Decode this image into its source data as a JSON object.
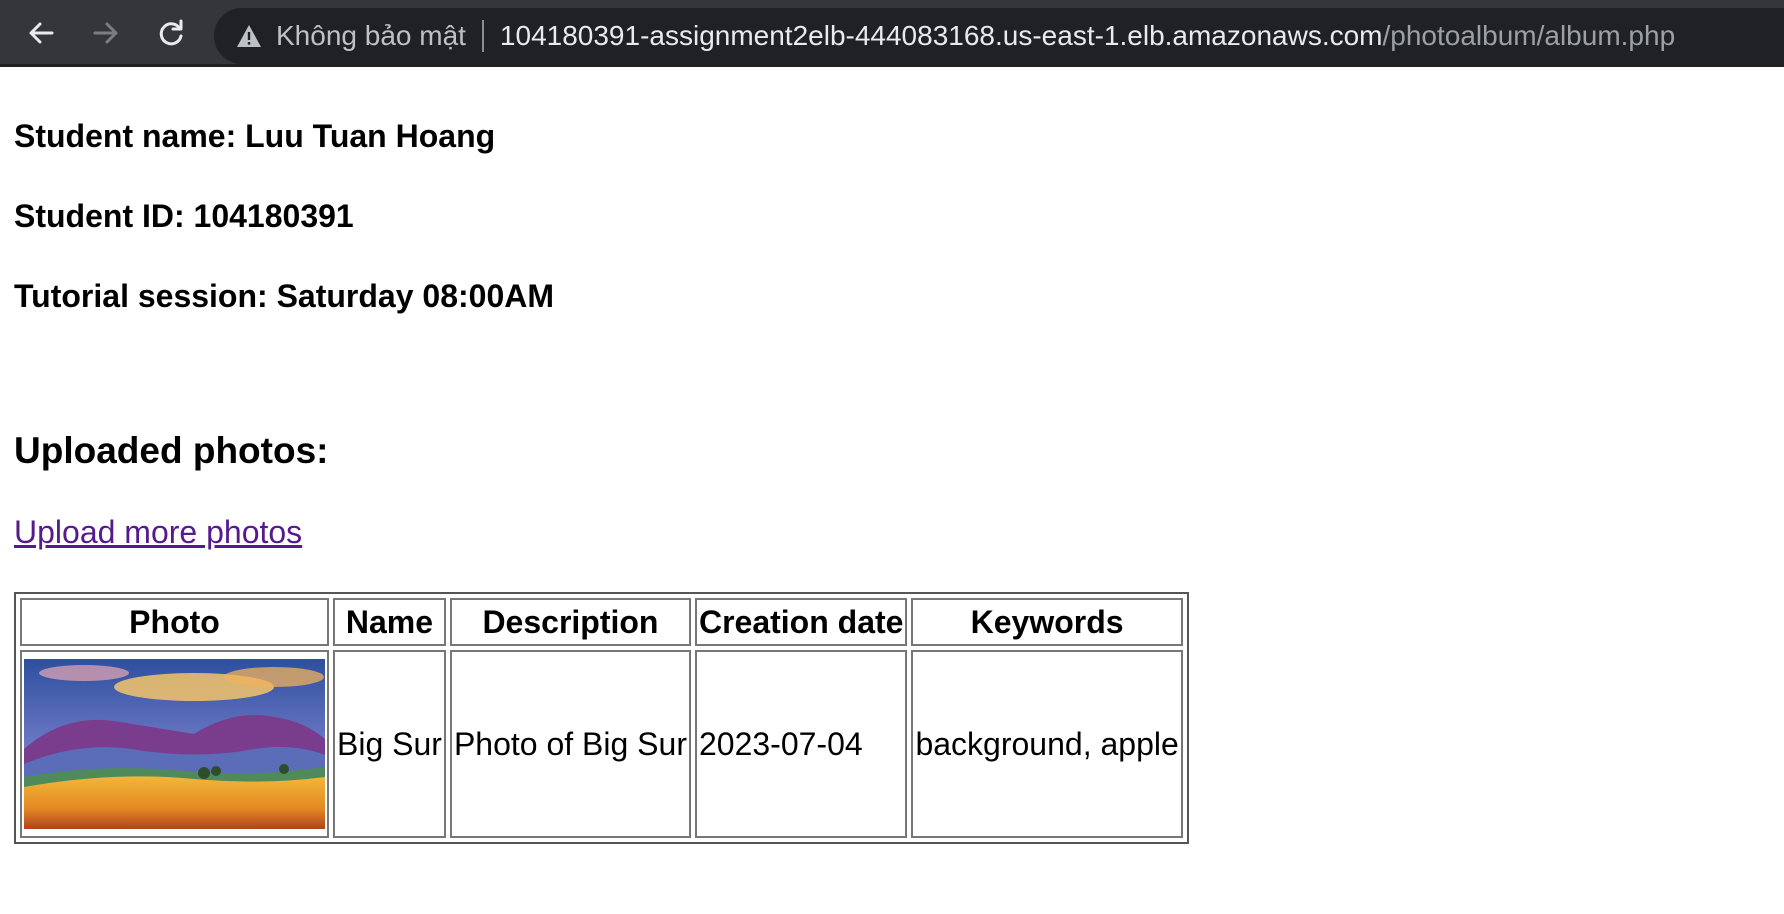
{
  "browser": {
    "security_label": "Không bảo mật",
    "url_host": "104180391-assignment2elb-444083168.us-east-1.elb.amazonaws.com",
    "url_path": "/photoalbum/album.php",
    "icons": [
      "back-arrow-icon",
      "forward-arrow-icon",
      "reload-icon",
      "warning-icon"
    ]
  },
  "student": {
    "name_line": "Student name: Luu Tuan Hoang",
    "id_line": "Student ID: 104180391",
    "session_line": "Tutorial session: Saturday 08:00AM"
  },
  "page": {
    "heading": "Uploaded photos:",
    "upload_link": "Upload more photos",
    "link_color": "#551a8b"
  },
  "table": {
    "headers": [
      "Photo",
      "Name",
      "Description",
      "Creation date",
      "Keywords"
    ],
    "rows": [
      {
        "photo_alt": "Big Sur",
        "name": "Big Sur",
        "description": "Photo of Big Sur",
        "creation_date": "2023-07-04",
        "keywords": "background, apple"
      }
    ]
  }
}
